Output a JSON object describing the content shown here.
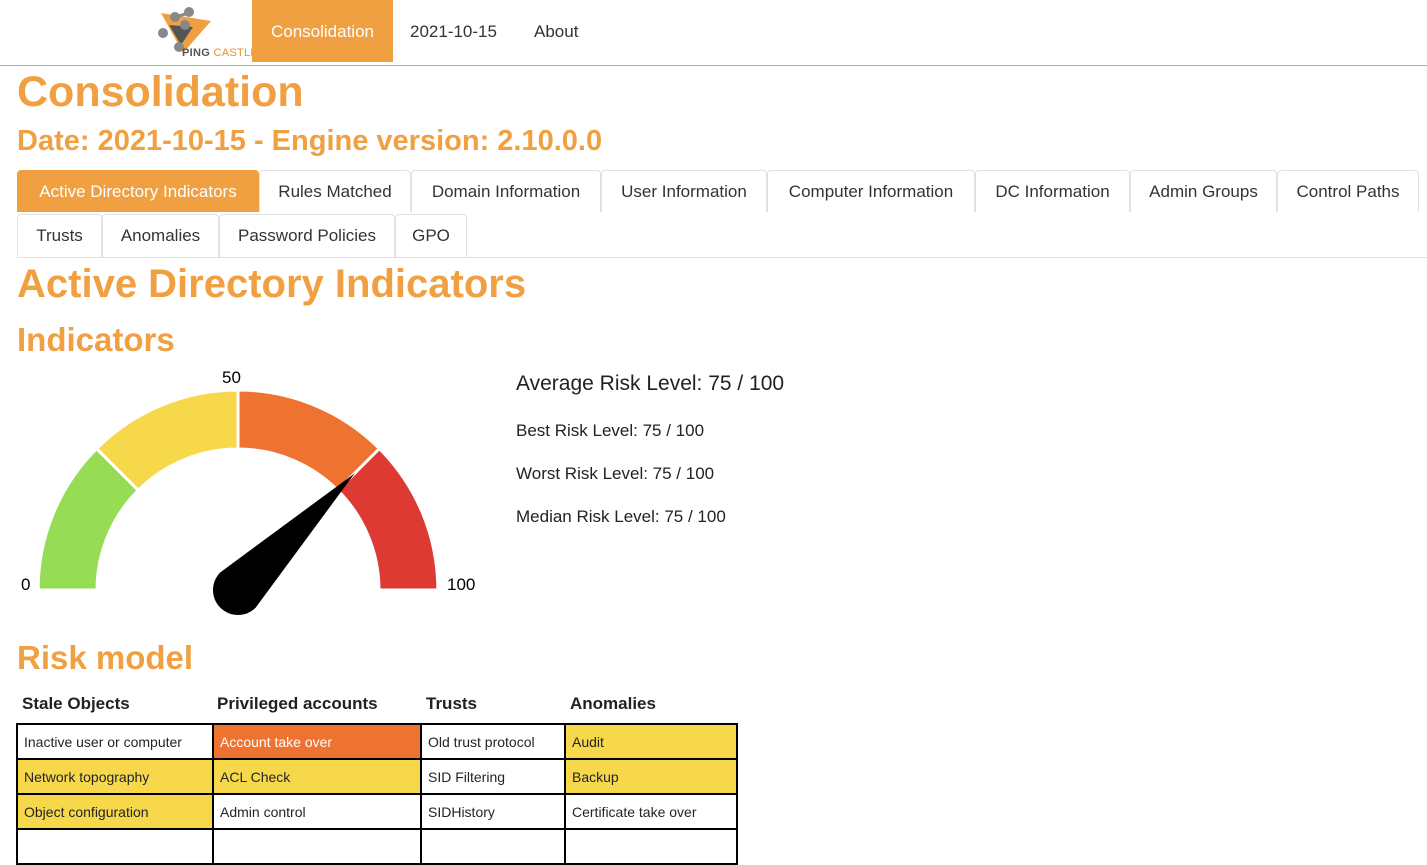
{
  "nav": {
    "logo_text_1": "PING",
    "logo_text_2": "CASTLE",
    "items": [
      "Consolidation",
      "2021-10-15",
      "About"
    ]
  },
  "page": {
    "title": "Consolidation",
    "subtitle": "Date: 2021-10-15 - Engine version: 2.10.0.0"
  },
  "tabs": {
    "row1": [
      "Active Directory Indicators",
      "Rules Matched",
      "Domain Information",
      "User Information",
      "Computer Information",
      "DC Information",
      "Admin Groups",
      "Control Paths"
    ],
    "row2": [
      "Trusts",
      "Anomalies",
      "Password Policies",
      "GPO"
    ],
    "active": "Active Directory Indicators"
  },
  "section": {
    "title": "Active Directory Indicators",
    "indicators_title": "Indicators",
    "risk_model_title": "Risk model"
  },
  "gauge": {
    "label_min": "0",
    "label_mid": "50",
    "label_max": "100",
    "value": 75,
    "colors": {
      "green": "#96dc55",
      "yellow": "#f8d84b",
      "orange": "#ee7331",
      "red": "#dd3a33"
    }
  },
  "risk_levels": {
    "average": "Average Risk Level: 75 / 100",
    "best": "Best Risk Level: 75 / 100",
    "worst": "Worst Risk Level: 75 / 100",
    "median": "Median Risk Level: 75 / 100"
  },
  "risk_model": {
    "headers": [
      "Stale Objects",
      "Privileged accounts",
      "Trusts",
      "Anomalies"
    ],
    "rows": [
      [
        {
          "text": "Inactive user or computer",
          "level": "none"
        },
        {
          "text": "Account take over",
          "level": "orange"
        },
        {
          "text": "Old trust protocol",
          "level": "none"
        },
        {
          "text": "Audit",
          "level": "yellow"
        }
      ],
      [
        {
          "text": "Network topography",
          "level": "yellow"
        },
        {
          "text": "ACL Check",
          "level": "yellow"
        },
        {
          "text": "SID Filtering",
          "level": "none"
        },
        {
          "text": "Backup",
          "level": "yellow"
        }
      ],
      [
        {
          "text": "Object configuration",
          "level": "yellow"
        },
        {
          "text": "Admin control",
          "level": "none"
        },
        {
          "text": "SIDHistory",
          "level": "none"
        },
        {
          "text": "Certificate take over",
          "level": "none"
        }
      ]
    ],
    "level_colors": {
      "none": "#ffffff",
      "yellow": "#f8d84b",
      "orange": "#ee7331"
    },
    "accent": "#f0a040"
  }
}
